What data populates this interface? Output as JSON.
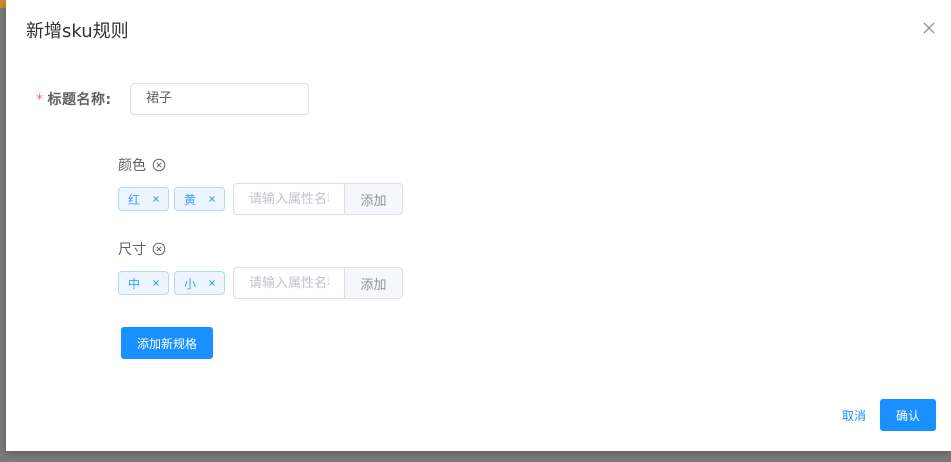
{
  "dialog": {
    "title": "新增sku规则"
  },
  "form": {
    "required_mark": "*",
    "title_label": "标题名称:",
    "title_value": "裙子"
  },
  "specs": [
    {
      "name": "颜色",
      "values": [
        "红",
        "黄"
      ],
      "input_placeholder": "请输入属性名称",
      "add_label": "添加"
    },
    {
      "name": "尺寸",
      "values": [
        "中",
        "小"
      ],
      "input_placeholder": "请输入属性名称",
      "add_label": "添加"
    }
  ],
  "actions": {
    "add_spec_label": "添加新规格",
    "cancel_label": "取消",
    "confirm_label": "确认"
  },
  "colors": {
    "primary": "#1890ff",
    "tag_bg": "#ecf5ff",
    "tag_border": "#b3d8ff",
    "tag_text": "#409eff",
    "required": "#f56c6c"
  }
}
